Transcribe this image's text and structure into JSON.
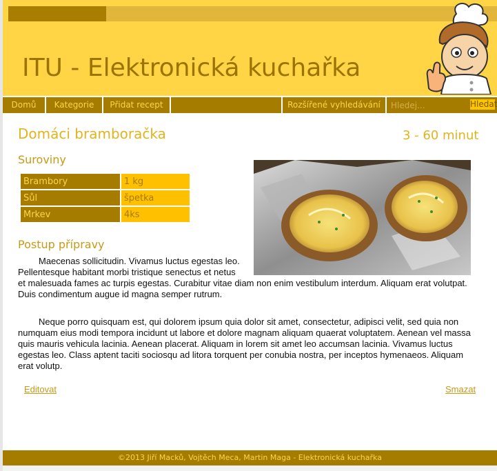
{
  "header": {
    "progress_fraction": 0.2,
    "site_title": "ITU - Elektronická kuchařka"
  },
  "nav": {
    "items": [
      "Domů",
      "Kategorie",
      "Přidat recept",
      "",
      "Rozšířené vyhledávání"
    ],
    "search_placeholder": "Hledej...",
    "search_button": "Hledat"
  },
  "recipe": {
    "title": "Domáci bramboračka",
    "time": "3 - 60 minut",
    "ingredients_heading": "Suroviny",
    "ingredients": [
      {
        "name": "Brambory",
        "qty": "1 kg"
      },
      {
        "name": "Sůl",
        "qty": "špetka"
      },
      {
        "name": "Mrkev",
        "qty": "4ks"
      }
    ],
    "steps_heading": "Postup přípravy",
    "paragraph_1": "Maecenas sollicitudin. Vivamus luctus egestas leo. Pellentesque habitant morbi tristique senectus et netus et malesuada fames ac turpis egestas. Curabitur vitae diam non enim vestibulum interdum. Aliquam erat volutpat. Duis condimentum augue id magna semper rutrum.",
    "paragraph_2": "Neque porro quisquam est, qui dolorem ipsum quia dolor sit amet, consectetur, adipisci velit, sed quia non numquam eius modi tempora incidunt ut labore et dolore magnam aliquam quaerat voluptatem. Aenean vel massa quis mauris vehicula lacinia. Aenean placerat. Aliquam in lorem sit amet leo accumsan lacinia. Vivamus luctus egestas leo. Class aptent taciti sociosqu ad litora torquent per conubia nostra, per inceptos hymenaeos. Aliquam erat volutp."
  },
  "actions": {
    "edit": "Editovat",
    "delete": "Smazat"
  },
  "footer": {
    "text": "©2013 Jiří Macků, Vojtěch Meca, Martin Maga - Elektronická kuchařka"
  },
  "colors": {
    "header_bg": "#ffd445",
    "nav_bg": "#a67c00",
    "accent": "#ffc000",
    "title_text": "#9b7300"
  },
  "icons": {
    "logo": "chef-icon",
    "photo": "baked-potato-image"
  }
}
